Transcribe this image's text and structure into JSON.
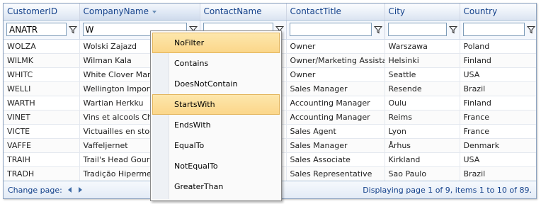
{
  "columns": [
    {
      "label": "CustomerID",
      "filter": "ANATR"
    },
    {
      "label": "CompanyName",
      "filter": "W",
      "sorted": true
    },
    {
      "label": "ContactName",
      "filter": ""
    },
    {
      "label": "ContactTitle",
      "filter": ""
    },
    {
      "label": "City",
      "filter": ""
    },
    {
      "label": "Country",
      "filter": ""
    }
  ],
  "rows": [
    [
      "WOLZA",
      "Wolski Zajazd",
      "",
      "Owner",
      "Warszawa",
      "Poland"
    ],
    [
      "WILMK",
      "Wilman Kala",
      "",
      "Owner/Marketing Assistant",
      "Helsinki",
      "Finland"
    ],
    [
      "WHITC",
      "White Clover Markets",
      "",
      "Owner",
      "Seattle",
      "USA"
    ],
    [
      "WELLI",
      "Wellington Importadora",
      "",
      "Sales Manager",
      "Resende",
      "Brazil"
    ],
    [
      "WARTH",
      "Wartian Herkku",
      "",
      "Accounting Manager",
      "Oulu",
      "Finland"
    ],
    [
      "VINET",
      "Vins et alcools Chevalier",
      "",
      "Accounting Manager",
      "Reims",
      "France"
    ],
    [
      "VICTE",
      "Victuailles en stock",
      "",
      "Sales Agent",
      "Lyon",
      "France"
    ],
    [
      "VAFFE",
      "Vaffeljernet",
      "",
      "Sales Manager",
      "Århus",
      "Denmark"
    ],
    [
      "TRAIH",
      "Trail's Head Gourmet Provisioners",
      "",
      "Sales Associate",
      "Kirkland",
      "USA"
    ],
    [
      "TRADH",
      "Tradição Hipermercados",
      "",
      "Sales Representative",
      "Sao Paulo",
      "Brazil"
    ]
  ],
  "pager": {
    "label": "Change page:",
    "info": "Displaying page 1 of 9, items 1 to 10 of 89."
  },
  "filter_menu": {
    "items": [
      "NoFilter",
      "Contains",
      "DoesNotContain",
      "StartsWith",
      "EndsWith",
      "EqualTo",
      "NotEqualTo",
      "GreaterThan"
    ],
    "highlighted": [
      "NoFilter",
      "StartsWith"
    ]
  },
  "colors": {
    "header_text": "#15428b",
    "highlight": "#fbd68a",
    "border": "#8ea4c1"
  },
  "icons": {
    "filter": "funnel-icon",
    "sort": "sort-desc-icon",
    "prev": "prev-page-icon",
    "next": "next-page-icon"
  }
}
